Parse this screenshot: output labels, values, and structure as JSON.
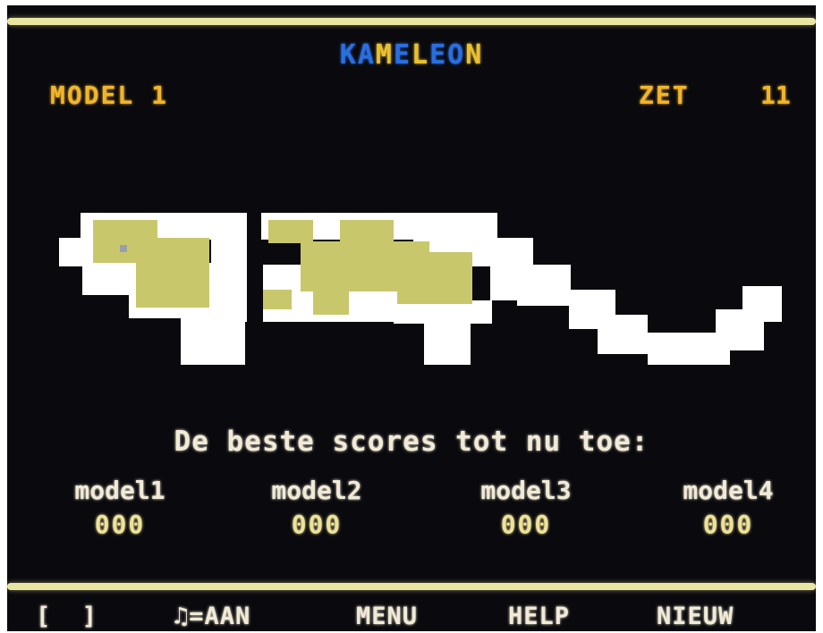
{
  "game": {
    "title": "KAMELEON",
    "title_colors": [
      "#2a6fe0",
      "#2a6fe0",
      "#e8c030",
      "#2a6fe0",
      "#e8c030",
      "#2a6fe0",
      "#2a6fe0",
      "#e8c030"
    ],
    "model_label": "MODEL 1",
    "move_label": "ZET",
    "move_count": "11"
  },
  "board": {
    "colors": {
      "white": "#ffffff",
      "olive": "#c9c76c"
    },
    "cursor_color": "#9aa0a8"
  },
  "scores": {
    "heading": "De beste scores tot nu toe:",
    "entries": [
      {
        "name": "model1",
        "value": "000"
      },
      {
        "name": "model2",
        "value": "000"
      },
      {
        "name": "model3",
        "value": "000"
      },
      {
        "name": "model4",
        "value": "000"
      }
    ]
  },
  "menu": {
    "bracket": "[  ]",
    "music": "♫=AAN",
    "menu": "MENU",
    "help": "HELP",
    "new": "NIEUW"
  },
  "colors": {
    "screen_bg": "#0a0a0e",
    "rule": "#e8e6a0",
    "label_yellow": "#f2b52a",
    "score_text": "#f1ead7",
    "score_value": "#ede29a"
  }
}
